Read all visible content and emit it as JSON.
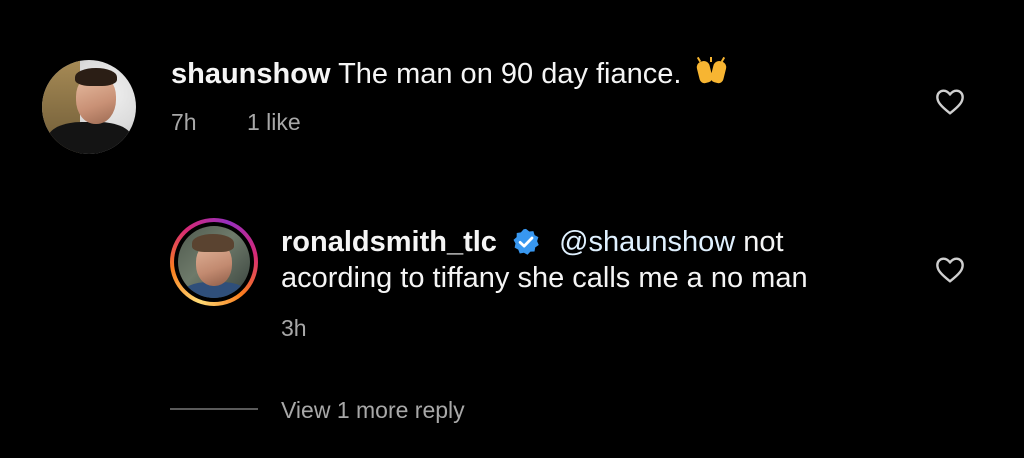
{
  "comments": [
    {
      "username": "shaunshow",
      "text": "The man on 90 day fiance.",
      "emoji": "raising-hands",
      "time": "7h",
      "likes": "1 like"
    }
  ],
  "reply": {
    "username": "ronaldsmith_tlc",
    "verified": true,
    "mention": "@shaunshow",
    "text_line1": "not",
    "text_line2": "acording to tiffany she calls me a no man",
    "time": "3h"
  },
  "view_replies_label": "View 1 more reply",
  "colors": {
    "background": "#000000",
    "primary_text": "#f5f5f5",
    "secondary_text": "#a8a8a8",
    "verified_badge": "#3897f0"
  }
}
